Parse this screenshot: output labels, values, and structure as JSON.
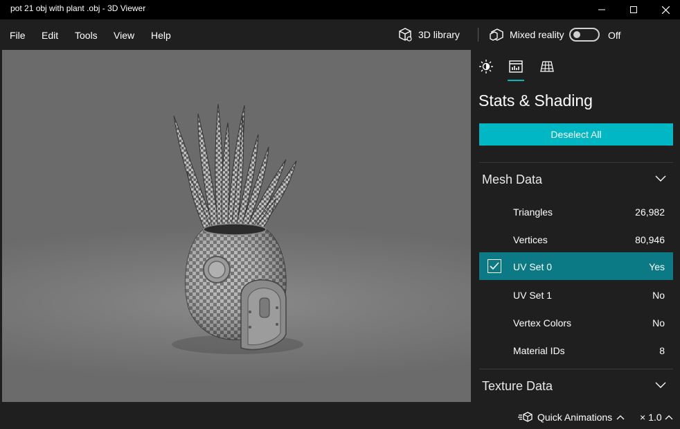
{
  "window": {
    "title": "pot 21 obj with plant .obj - 3D Viewer"
  },
  "menu": {
    "file": "File",
    "edit": "Edit",
    "tools": "Tools",
    "view": "View",
    "help": "Help"
  },
  "toolbar": {
    "library_label": "3D library",
    "mixed_reality_label": "Mixed reality",
    "toggle_state": "Off"
  },
  "panel": {
    "title": "Stats & Shading",
    "deselect_label": "Deselect All",
    "mesh_section": "Mesh Data",
    "texture_section": "Texture Data",
    "rows": [
      {
        "label": "Triangles",
        "value": "26,982"
      },
      {
        "label": "Vertices",
        "value": "80,946"
      },
      {
        "label": "UV Set 0",
        "value": "Yes"
      },
      {
        "label": "UV Set 1",
        "value": "No"
      },
      {
        "label": "Vertex Colors",
        "value": "No"
      },
      {
        "label": "Material IDs",
        "value": "8"
      }
    ]
  },
  "bottom": {
    "quick_animations": "Quick Animations",
    "zoom_prefix": "×",
    "zoom": "1.0"
  },
  "colors": {
    "accent": "#00b7c3",
    "selected_row": "#0b7a85",
    "background": "#1f1f1f"
  },
  "icons": [
    "cube-icon",
    "mixed-reality-icon",
    "sun-icon",
    "stats-icon",
    "grid-icon",
    "chevron-down-icon",
    "chevron-up-icon",
    "check-icon",
    "animation-icon"
  ]
}
